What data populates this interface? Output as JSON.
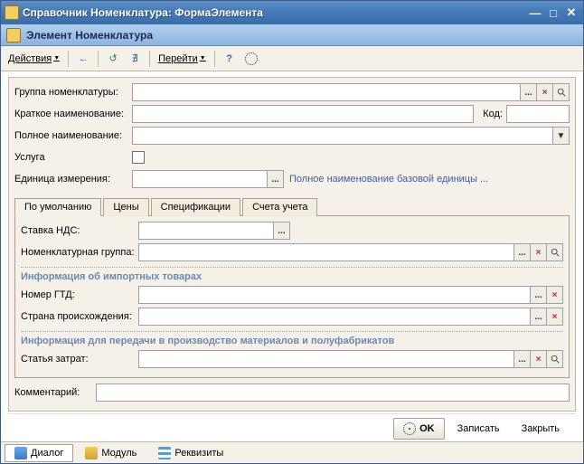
{
  "window": {
    "title": "Справочник Номенклатура: ФормаЭлемента"
  },
  "subheader": {
    "title": "Элемент Номенклатура"
  },
  "toolbar": {
    "actions": "Действия",
    "goto": "Перейти"
  },
  "form": {
    "group_label": "Группа номенклатуры:",
    "short_name_label": "Краткое наименование:",
    "code_label": "Код:",
    "full_name_label": "Полное наименование:",
    "service_label": "Услуга",
    "unit_label": "Единица измерения:",
    "unit_hint": "Полное наименование базовой единицы ..."
  },
  "tabs": {
    "items": [
      {
        "label": "По умолчанию"
      },
      {
        "label": "Цены"
      },
      {
        "label": "Спецификации"
      },
      {
        "label": "Счета учета"
      }
    ]
  },
  "tab_content": {
    "vat_label": "Ставка НДС:",
    "nomen_group_label": "Номенклатурная группа:",
    "import_section": "Информация об импортных товарах",
    "gtd_label": "Номер ГТД:",
    "country_label": "Страна происхождения:",
    "prod_section": "Информация для передачи в производство материалов и полуфабрикатов",
    "cost_item_label": "Статья затрат:"
  },
  "comment_label": "Комментарий:",
  "buttons": {
    "ok": "OK",
    "write": "Записать",
    "close": "Закрыть"
  },
  "status": {
    "tabs": [
      {
        "label": "Диалог"
      },
      {
        "label": "Модуль"
      },
      {
        "label": "Реквизиты"
      }
    ]
  }
}
